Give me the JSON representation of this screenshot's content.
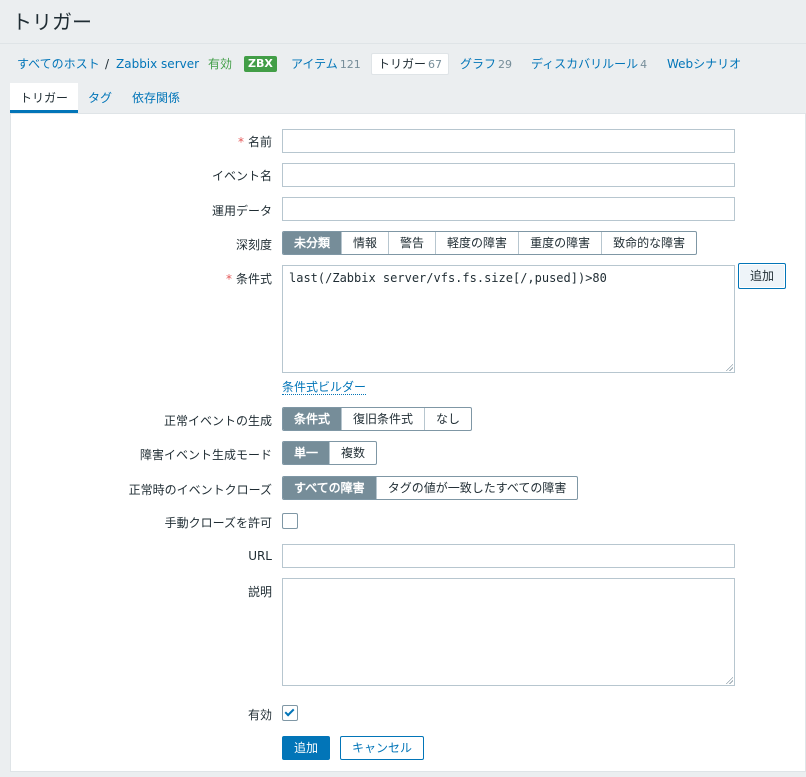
{
  "page_title": "トリガー",
  "host_nav": {
    "all_hosts": "すべてのホスト",
    "separator": "/",
    "host": "Zabbix server",
    "status": "有効",
    "zbx_badge": "ZBX",
    "items": {
      "label": "アイテム",
      "count": "121"
    },
    "triggers": {
      "label": "トリガー",
      "count": "67"
    },
    "graphs": {
      "label": "グラフ",
      "count": "29"
    },
    "discovery": {
      "label": "ディスカバリルール",
      "count": "4"
    },
    "web": {
      "label": "Webシナリオ"
    }
  },
  "tabs": [
    "トリガー",
    "タグ",
    "依存関係"
  ],
  "form": {
    "name": {
      "label": "名前",
      "required": "*",
      "value": ""
    },
    "event_name": {
      "label": "イベント名",
      "value": ""
    },
    "opdata": {
      "label": "運用データ",
      "value": ""
    },
    "severity": {
      "label": "深刻度",
      "options": [
        "未分類",
        "情報",
        "警告",
        "軽度の障害",
        "重度の障害",
        "致命的な障害"
      ],
      "selected": "未分類"
    },
    "expression": {
      "label": "条件式",
      "required": "*",
      "value": "last(/Zabbix server/vfs.fs.size[/,pused])>80",
      "add_button": "追加",
      "builder_link": "条件式ビルダー"
    },
    "ok_event_generation": {
      "label": "正常イベントの生成",
      "options": [
        "条件式",
        "復旧条件式",
        "なし"
      ],
      "selected": "条件式"
    },
    "problem_event_mode": {
      "label": "障害イベント生成モード",
      "options": [
        "単一",
        "複数"
      ],
      "selected": "単一"
    },
    "ok_event_closes": {
      "label": "正常時のイベントクローズ",
      "options": [
        "すべての障害",
        "タグの値が一致したすべての障害"
      ],
      "selected": "すべての障害"
    },
    "manual_close": {
      "label": "手動クローズを許可",
      "checked": false
    },
    "url": {
      "label": "URL",
      "value": ""
    },
    "description": {
      "label": "説明",
      "value": ""
    },
    "enabled": {
      "label": "有効",
      "checked": true
    }
  },
  "buttons": {
    "add": "追加",
    "cancel": "キャンセル"
  },
  "colors": {
    "accent": "#0275b8",
    "selected_segment": "#768d99",
    "required": "#e45959",
    "zbx_badge": "#429e47"
  }
}
